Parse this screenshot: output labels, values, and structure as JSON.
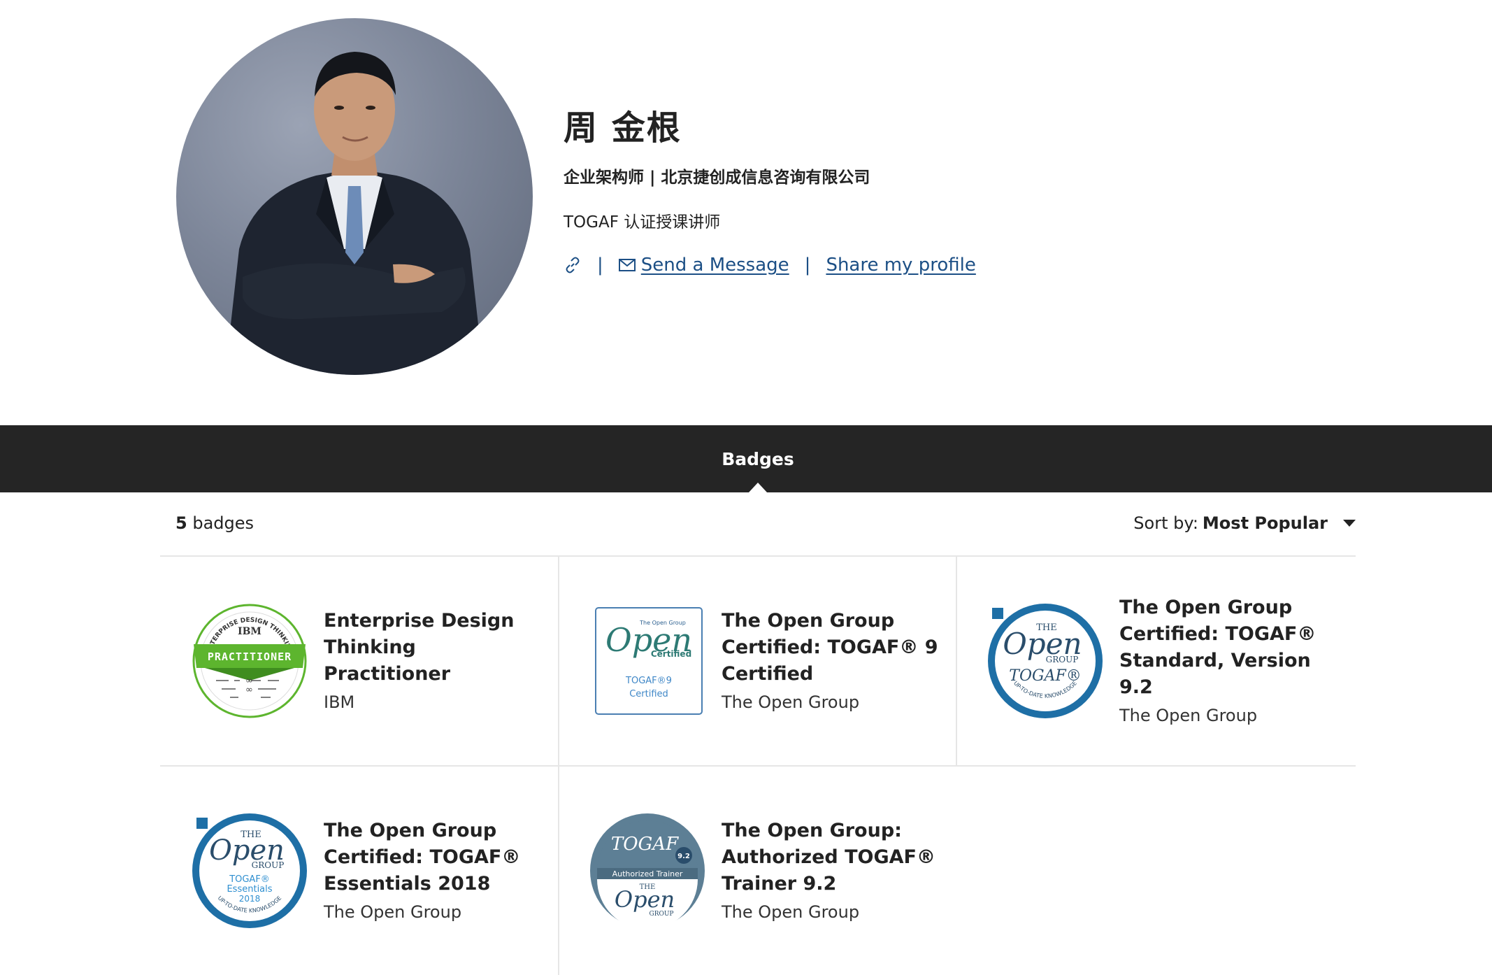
{
  "profile": {
    "name": "周 金根",
    "subtitle": "企业架构师 | 北京捷创成信息咨询有限公司",
    "bio": "TOGAF 认证授课讲师",
    "send_message": "Send a Message",
    "share_profile": "Share my profile",
    "separator": "|"
  },
  "tabs": {
    "badges": "Badges"
  },
  "toolbar": {
    "count_number": "5",
    "count_label": "badges",
    "sort_label": "Sort by:",
    "sort_value": "Most Popular"
  },
  "badges": [
    {
      "title": "Enterprise Design Thinking Practitioner",
      "issuer": "IBM",
      "art": {
        "ring_text": "ENTERPRISE DESIGN THINKING",
        "brand": "IBM",
        "ribbon": "PRACTITIONER"
      }
    },
    {
      "title": "The Open Group Certified: TOGAF® 9 Certified",
      "issuer": "The Open Group",
      "art": {
        "small": "The Open Group",
        "brand": "Open",
        "sub": "Certified",
        "line1": "TOGAF®9",
        "line2": "Certified"
      }
    },
    {
      "title": "The Open Group Certified: TOGAF® Standard, Version 9.2",
      "issuer": "The Open Group",
      "art": {
        "the": "THE",
        "brand": "Open",
        "group": "GROUP",
        "product": "TOGAF®",
        "ring_text": "UP-TO-DATE KNOWLEDGE"
      }
    },
    {
      "title": "The Open Group Certified: TOGAF® Essentials 2018",
      "issuer": "The Open Group",
      "art": {
        "the": "THE",
        "brand": "Open",
        "group": "GROUP",
        "product": "TOGAF®",
        "product2": "Essentials",
        "year": "2018",
        "ring_text": "UP-TO-DATE KNOWLEDGE"
      }
    },
    {
      "title": "The Open Group: Authorized TOGAF® Trainer 9.2",
      "issuer": "The Open Group",
      "art": {
        "product": "TOGAF",
        "version": "9.2",
        "band": "Authorized Trainer",
        "the": "THE",
        "brand": "Open",
        "group": "GROUP"
      }
    }
  ],
  "colors": {
    "tabbar": "#252525",
    "link": "#1c4f85",
    "ibm_green": "#5db52e",
    "opengroup_blue": "#1f7fbf",
    "trainer_slate": "#5d7f95"
  }
}
